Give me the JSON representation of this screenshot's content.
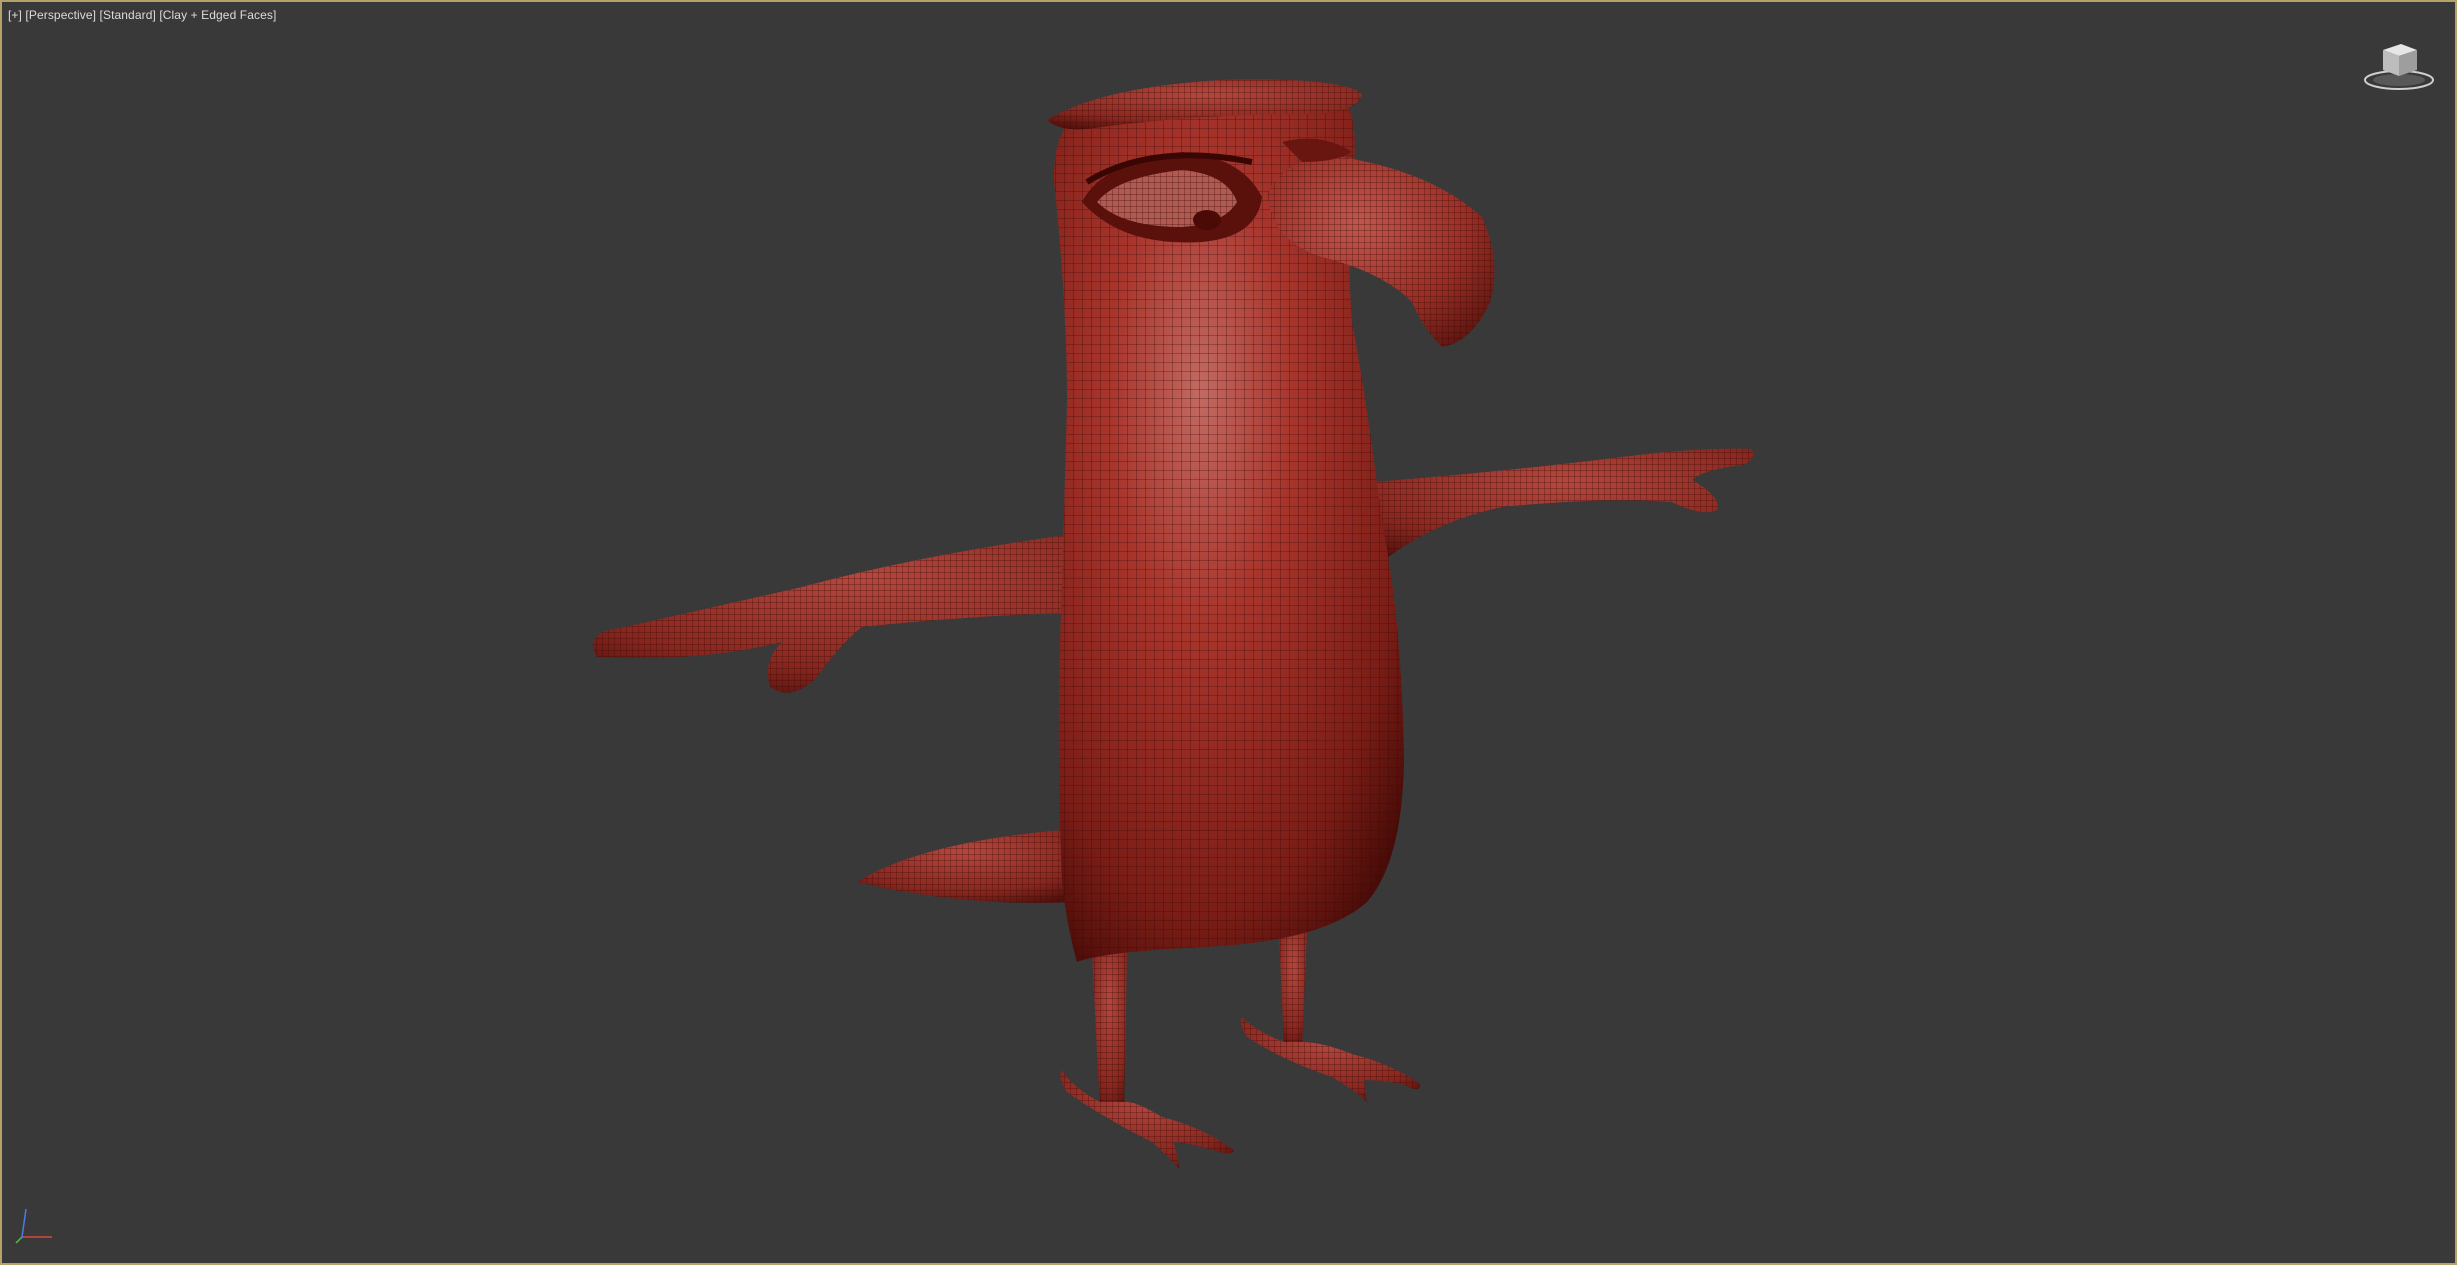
{
  "viewport": {
    "label_plus": "[+]",
    "label_view": "[Perspective]",
    "label_shading": "[Standard]",
    "label_display": "[Clay + Edged Faces]"
  },
  "colors": {
    "background": "#393939",
    "border": "#b3a26a",
    "clay": "#a8352c",
    "clay_dark": "#6a1610",
    "wire": "#3a0806"
  },
  "icons": {
    "viewcube": "viewcube-icon",
    "axis": "axis-tripod-icon"
  }
}
